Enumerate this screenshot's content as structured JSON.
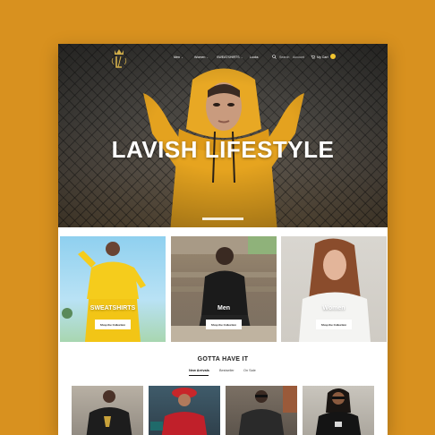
{
  "nav": {
    "items": [
      {
        "label": "Men",
        "caret": "›"
      },
      {
        "label": "Women",
        "caret": "›"
      },
      {
        "label": "SWEATSHIRTS",
        "caret": "›"
      },
      {
        "label": "Looks",
        "caret": ""
      }
    ],
    "search_label": "Search",
    "account_label": "Account",
    "cart_label": "My Cart",
    "cart_count": "0"
  },
  "hero": {
    "title": "LAVISH LIFESTYLE"
  },
  "categories": [
    {
      "label": "SWEATSHIRTS",
      "button": "Shop the Collection"
    },
    {
      "label": "Men",
      "button": "Shop the Collection"
    },
    {
      "label": "Women",
      "button": "Shop the Collection"
    }
  ],
  "section": {
    "title": "GOTTA HAVE IT",
    "tabs": [
      "New Arrivals",
      "Bestseller",
      "On Sale"
    ]
  },
  "colors": {
    "background": "#d8911f",
    "accent": "#f2c530",
    "hoodie": "#e8a520"
  },
  "icons": {
    "search": "search-icon",
    "cart": "cart-icon",
    "logo": "crown-monogram-logo"
  }
}
